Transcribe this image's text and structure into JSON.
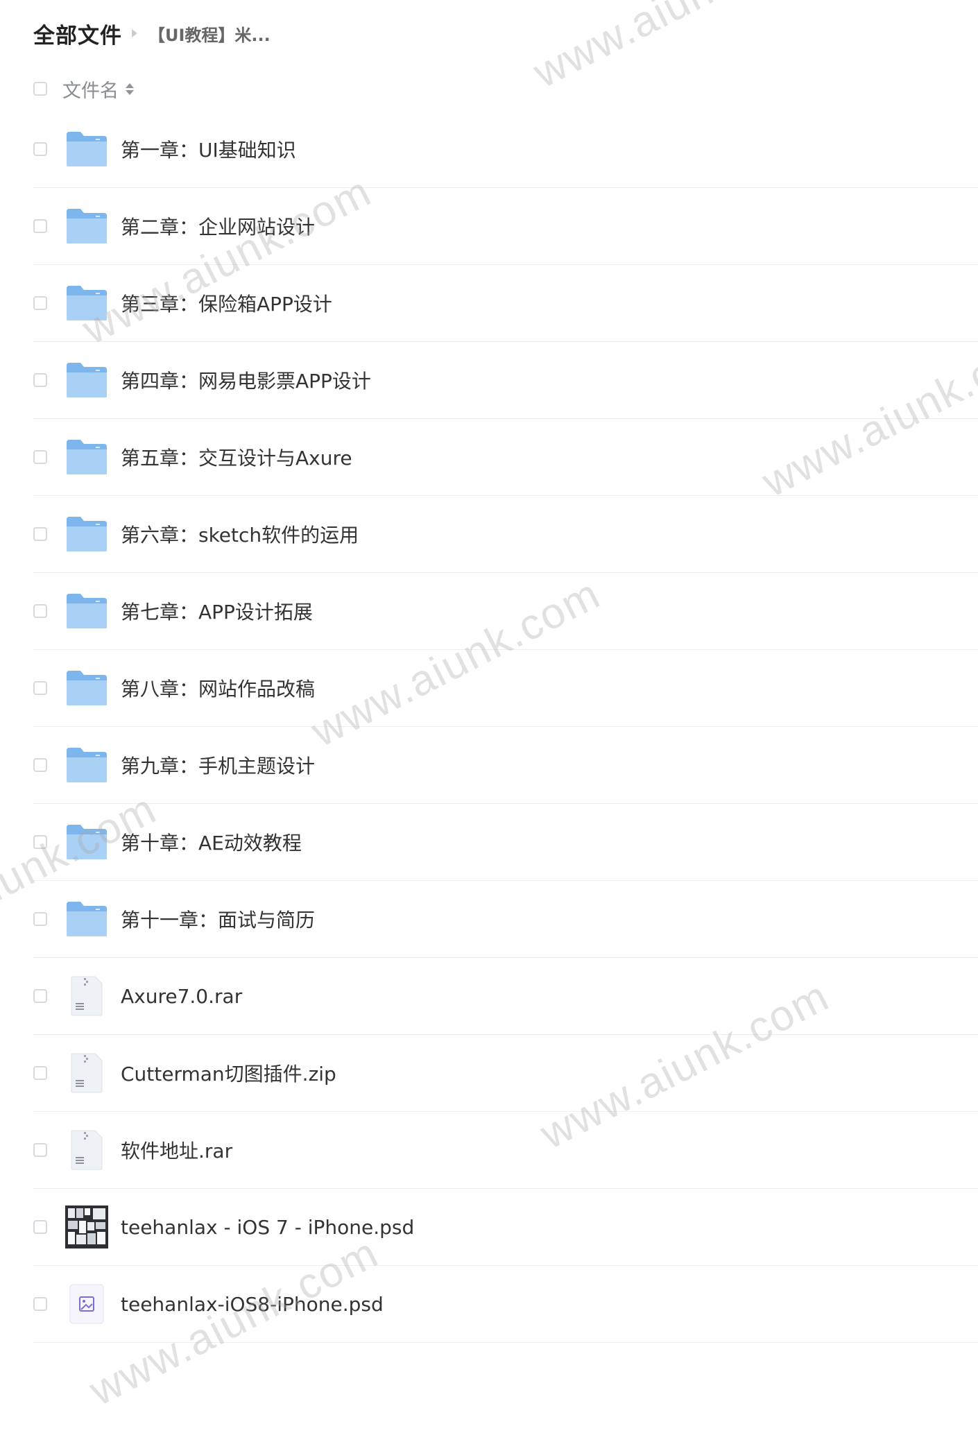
{
  "breadcrumb": {
    "root": "全部文件",
    "current": "【UI教程】米..."
  },
  "list_header": {
    "name_label": "文件名"
  },
  "files": [
    {
      "name": "第一章：UI基础知识",
      "type": "folder"
    },
    {
      "name": "第二章：企业网站设计",
      "type": "folder"
    },
    {
      "name": "第三章：保险箱APP设计",
      "type": "folder"
    },
    {
      "name": "第四章：网易电影票APP设计",
      "type": "folder"
    },
    {
      "name": "第五章：交互设计与Axure",
      "type": "folder"
    },
    {
      "name": "第六章：sketch软件的运用",
      "type": "folder"
    },
    {
      "name": "第七章：APP设计拓展",
      "type": "folder"
    },
    {
      "name": "第八章：网站作品改稿",
      "type": "folder"
    },
    {
      "name": "第九章：手机主题设计",
      "type": "folder"
    },
    {
      "name": "第十章：AE动效教程",
      "type": "folder"
    },
    {
      "name": "第十一章：面试与简历",
      "type": "folder"
    },
    {
      "name": "Axure7.0.rar",
      "type": "archive"
    },
    {
      "name": "Cutterman切图插件.zip",
      "type": "archive"
    },
    {
      "name": "软件地址.rar",
      "type": "archive"
    },
    {
      "name": "teehanlax - iOS 7 - iPhone.psd",
      "type": "psd-thumbnail"
    },
    {
      "name": "teehanlax-iOS8-iPhone.psd",
      "type": "image"
    }
  ],
  "watermark_text": "www.aiunk.com",
  "colors": {
    "folder": "#7db6ec",
    "folder_light": "#a9d0f5",
    "archive_bg": "#eef1f5",
    "image_accent": "#7b6fd6"
  }
}
